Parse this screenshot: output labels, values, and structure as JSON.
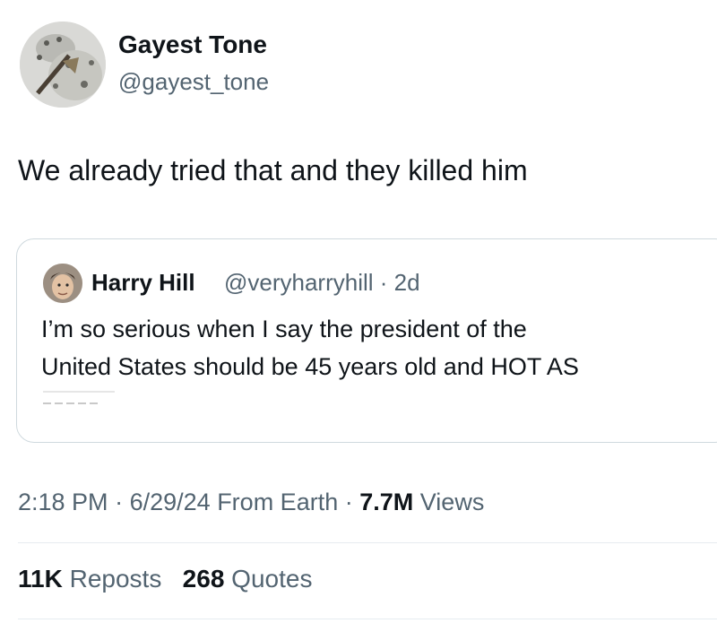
{
  "tweet": {
    "author_name": "Gayest Tone",
    "author_handle": "@gayest_tone",
    "text": "We already tried that and they killed him"
  },
  "quote": {
    "name": "Harry Hill",
    "handle_time": "@veryharryhill · 2d",
    "line1": "I’m so serious when I say the president of the",
    "line2": "United States should be 45 years old and HOT AS"
  },
  "meta": {
    "time": "2:18 PM",
    "date": "6/29/24",
    "source": "From Earth",
    "views_count": "7.7M",
    "views_label": "Views"
  },
  "stats": {
    "reposts_count": "11K",
    "reposts_label": "Reposts",
    "quotes_count": "268",
    "quotes_label": "Quotes"
  },
  "colors": {
    "text": "#0f1419",
    "secondary": "#536471",
    "border": "#cfd9de"
  },
  "icons": [
    "snow-leopard-avatar-image",
    "harry-hill-avatar-image"
  ]
}
